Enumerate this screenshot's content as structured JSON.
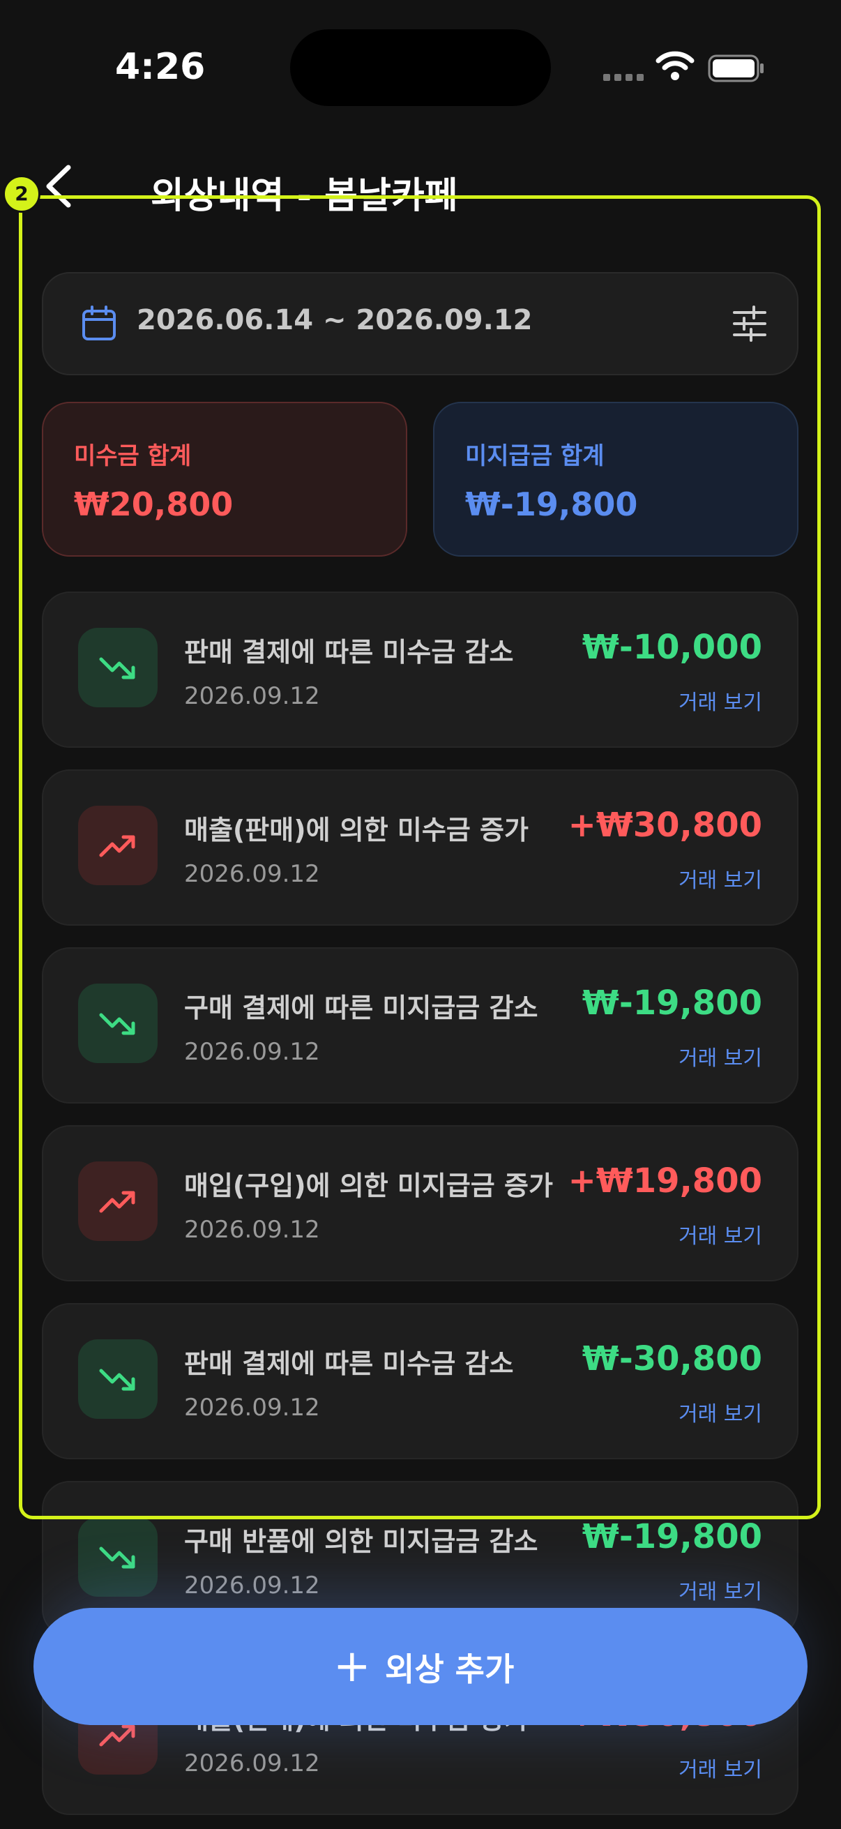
{
  "status_bar": {
    "time": "4:26"
  },
  "header": {
    "title": "외상내역 - 봄날카페"
  },
  "overlay": {
    "badge": "2"
  },
  "filter": {
    "date_range": "2026.06.14 ~ 2026.09.12"
  },
  "summary": {
    "receivable": {
      "label": "미수금 합계",
      "amount": "₩20,800"
    },
    "payable": {
      "label": "미지급금 합계",
      "amount": "₩-19,800"
    }
  },
  "transactions": [
    {
      "title": "판매 결제에 따른 미수금 감소",
      "date": "2026.09.12",
      "amount": "₩-10,000",
      "link": "거래 보기"
    },
    {
      "title": "매출(판매)에 의한 미수금 증가",
      "date": "2026.09.12",
      "amount": "+₩30,800",
      "link": "거래 보기"
    },
    {
      "title": "구매 결제에 따른 미지급금 감소",
      "date": "2026.09.12",
      "amount": "₩-19,800",
      "link": "거래 보기"
    },
    {
      "title": "매입(구입)에 의한 미지급금 증가",
      "date": "2026.09.12",
      "amount": "+₩19,800",
      "link": "거래 보기"
    },
    {
      "title": "판매 결제에 따른 미수금 감소",
      "date": "2026.09.12",
      "amount": "₩-30,800",
      "link": "거래 보기"
    },
    {
      "title": "구매 반품에 의한 미지급금 감소",
      "date": "2026.09.12",
      "amount": "₩-19,800",
      "link": "거래 보기"
    },
    {
      "title": "매출(판매)에 의한 미수금 증가",
      "date": "2026.09.12",
      "amount": "+₩30,800",
      "link": "거래 보기"
    }
  ],
  "fab": {
    "icon": "plus-icon",
    "label": "외상 추가"
  },
  "colors": {
    "background": "#121212",
    "accent": "#5b8df0",
    "increase": "#ff5b5b",
    "decrease": "#3ddc84",
    "highlight": "#d4f21a"
  }
}
